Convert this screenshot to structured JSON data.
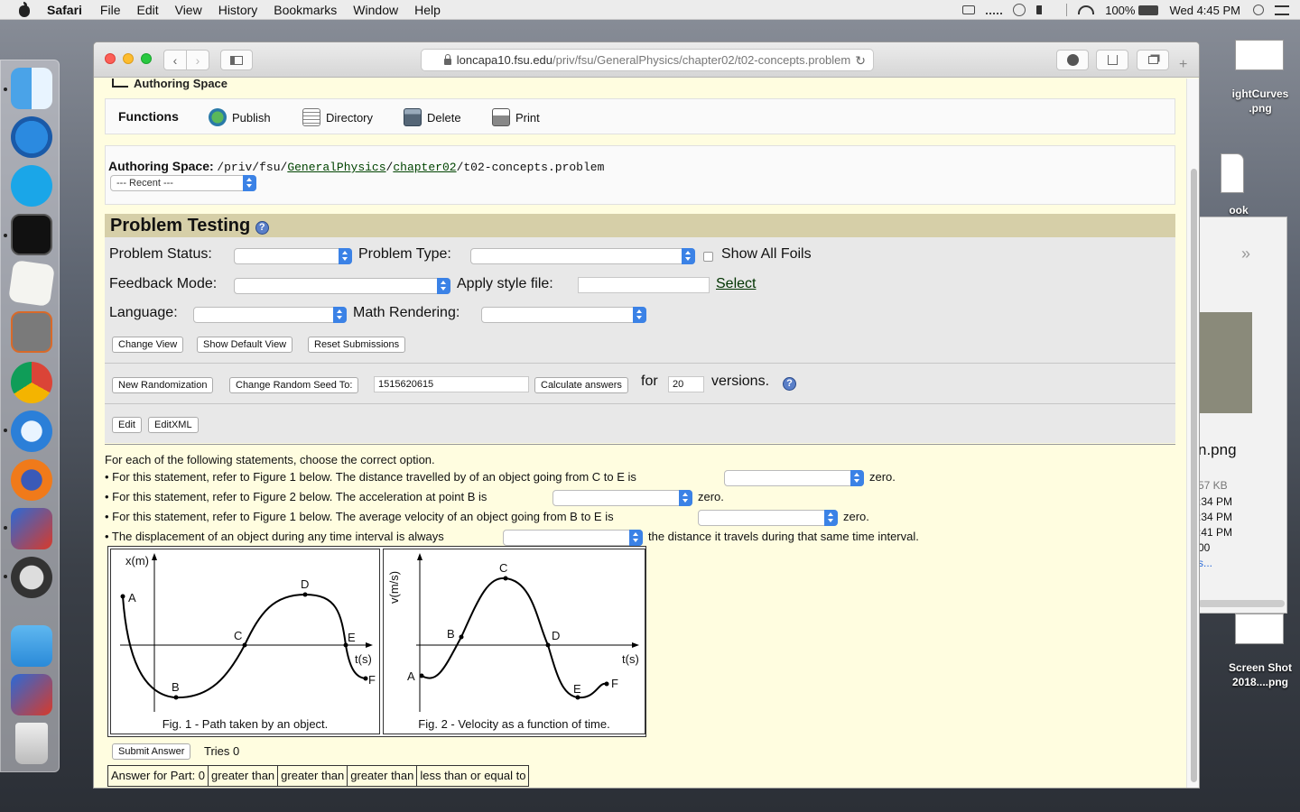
{
  "menubar": {
    "app": "Safari",
    "items": [
      "File",
      "Edit",
      "View",
      "History",
      "Bookmarks",
      "Window",
      "Help"
    ],
    "battery": "100%",
    "clock": "Wed 4:45 PM"
  },
  "desktop": {
    "icons": [
      {
        "label": "ightCurves\n.png"
      },
      {
        "label": "ook"
      },
      {
        "label": "Screen Shot\n2018....png"
      }
    ],
    "bgwindow": {
      "filename": "n.png",
      "size": "57 KB",
      "times": [
        ":34 PM",
        ":34 PM",
        ":41 PM",
        "00"
      ],
      "more": "s..."
    }
  },
  "browser": {
    "url_host": "loncapa10.fsu.edu",
    "url_path": "/priv/fsu/GeneralPhysics/chapter02/t02-concepts.problem"
  },
  "page": {
    "authoring_space_link": "Authoring Space",
    "functions_label": "Functions",
    "functions": [
      "Publish",
      "Directory",
      "Delete",
      "Print"
    ],
    "path_label": "Authoring Space:",
    "path_parts": [
      "/priv/fsu/",
      "GeneralPhysics",
      "/",
      "chapter02",
      "/t02-concepts.problem"
    ],
    "recent": "--- Recent ---",
    "problem_testing_title": "Problem Testing",
    "help_glyph": "?",
    "labels": {
      "problem_status": "Problem Status:",
      "problem_type": "Problem Type:",
      "show_all_foils": "Show All Foils",
      "feedback_mode": "Feedback Mode:",
      "apply_style": "Apply style file:",
      "select_link": "Select",
      "language": "Language:",
      "math_rendering": "Math Rendering:",
      "for": "for",
      "versions": "versions."
    },
    "buttons": {
      "change_view": "Change View",
      "show_default_view": "Show Default View",
      "reset_submissions": "Reset Submissions",
      "new_randomization": "New Randomization",
      "change_seed": "Change Random Seed To:",
      "calculate_answers": "Calculate answers",
      "edit": "Edit",
      "edit_xml": "EditXML",
      "submit_answer": "Submit Answer"
    },
    "seed_value": "1515620615",
    "versions_value": "20",
    "problem": {
      "intro": "For each of the following statements, choose the correct option.",
      "statements": [
        {
          "text": "• For this statement, refer to Figure 1 below. The distance travelled by of an object going from C to E is",
          "tail": "zero."
        },
        {
          "text": "• For this statement, refer to Figure 2 below. The acceleration at point B is",
          "tail": "zero."
        },
        {
          "text": "• For this statement, refer to Figure 1 below. The average velocity of an object going from B to E is",
          "tail": "zero."
        },
        {
          "text": "• The displacement of an object during any time interval is always",
          "tail": "the distance it travels during that same time interval."
        }
      ],
      "fig1": {
        "ylabel": "x(m)",
        "xlabel": "t(s)",
        "points": [
          "A",
          "B",
          "C",
          "D",
          "E",
          "F"
        ],
        "caption": "Fig. 1 - Path taken by an object."
      },
      "fig2": {
        "ylabel": "v(m/s)",
        "xlabel": "t(s)",
        "points": [
          "A",
          "B",
          "C",
          "D",
          "E",
          "F"
        ],
        "caption": "Fig. 2 - Velocity as a function of time."
      },
      "tries": "Tries 0",
      "answer_table": [
        "Answer for Part: 0",
        "greater than",
        "greater than",
        "greater than",
        "less than or equal to"
      ]
    }
  }
}
